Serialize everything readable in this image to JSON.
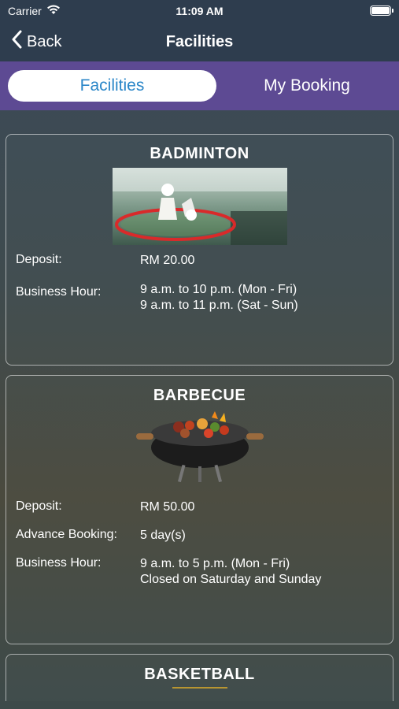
{
  "status": {
    "carrier": "Carrier",
    "time": "11:09 AM"
  },
  "nav": {
    "back_label": "Back",
    "title": "Facilities"
  },
  "tabs": [
    {
      "label": "Facilities",
      "active": true
    },
    {
      "label": "My Booking",
      "active": false
    }
  ],
  "colors": {
    "accent": "#2a86c8",
    "tab_bar": "#5d4a93",
    "nav_bar": "#2e3d4e"
  },
  "facilities": [
    {
      "name": "BADMINTON",
      "deposit_label": "Deposit:",
      "deposit": "RM 20.00",
      "hours_label": "Business Hour:",
      "hours": [
        "9 a.m. to 10 p.m. (Mon - Fri)",
        "9 a.m. to 11 p.m. (Sat - Sun)"
      ],
      "image": "badminton-shuttlecock-racket-photo"
    },
    {
      "name": "BARBECUE",
      "deposit_label": "Deposit:",
      "deposit": "RM 50.00",
      "advance_label": "Advance Booking:",
      "advance": "5 day(s)",
      "hours_label": "Business Hour:",
      "hours": [
        "9 a.m. to 5 p.m. (Mon - Fri)",
        "Closed on Saturday and Sunday"
      ],
      "image": "barbecue-grill-photo"
    },
    {
      "name": "BASKETBALL"
    }
  ]
}
